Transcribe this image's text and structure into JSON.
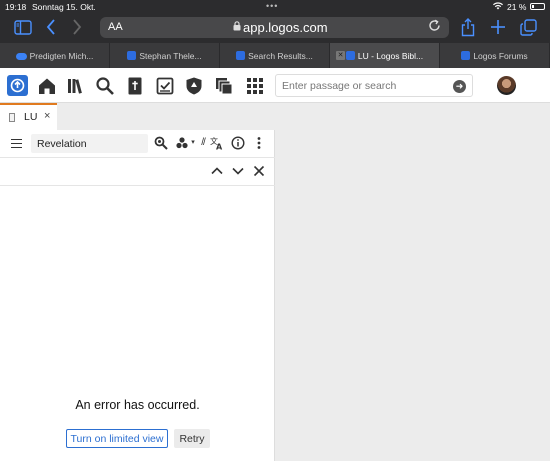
{
  "status_bar": {
    "time": "19:18",
    "date": "Sonntag 15. Okt.",
    "battery_percent": "21 %",
    "battery_level": 0.21,
    "multitask_dots": "•••"
  },
  "safari": {
    "text_size_label": "AA",
    "url": "app.logos.com",
    "icons": [
      "sidebar-icon",
      "back-icon",
      "forward-icon",
      "lock-icon",
      "reload-icon",
      "share-icon",
      "new-tab-icon",
      "tabs-icon"
    ]
  },
  "browser_tabs": [
    {
      "title": "Predigten Mich...",
      "favicon": "cloud-icon",
      "active": false
    },
    {
      "title": "Stephan Thele...",
      "favicon": "logos-favicon",
      "active": false
    },
    {
      "title": "Search Results...",
      "favicon": "logos-favicon",
      "active": false
    },
    {
      "title": "LU - Logos Bibl...",
      "favicon": "logos-favicon",
      "active": true
    },
    {
      "title": "Logos Forums",
      "favicon": "logos-favicon",
      "active": false
    }
  ],
  "app_toolbar": {
    "icons": [
      "logos-logo",
      "home-icon",
      "library-icon",
      "search-icon",
      "bible-icon",
      "checklist-icon",
      "shield-icon",
      "layouts-icon",
      "apps-grid-icon"
    ],
    "search_placeholder": "Enter passage or search",
    "accent_color": "#2c6fd1"
  },
  "panel": {
    "tab_label": "LU",
    "tab_close": "×",
    "tab_accent": "#e07a1f",
    "reference_value": "Revelation",
    "parallel_label": "//",
    "error_message": "An error has occurred.",
    "limited_view_label": "Turn on limited view",
    "retry_label": "Retry"
  }
}
